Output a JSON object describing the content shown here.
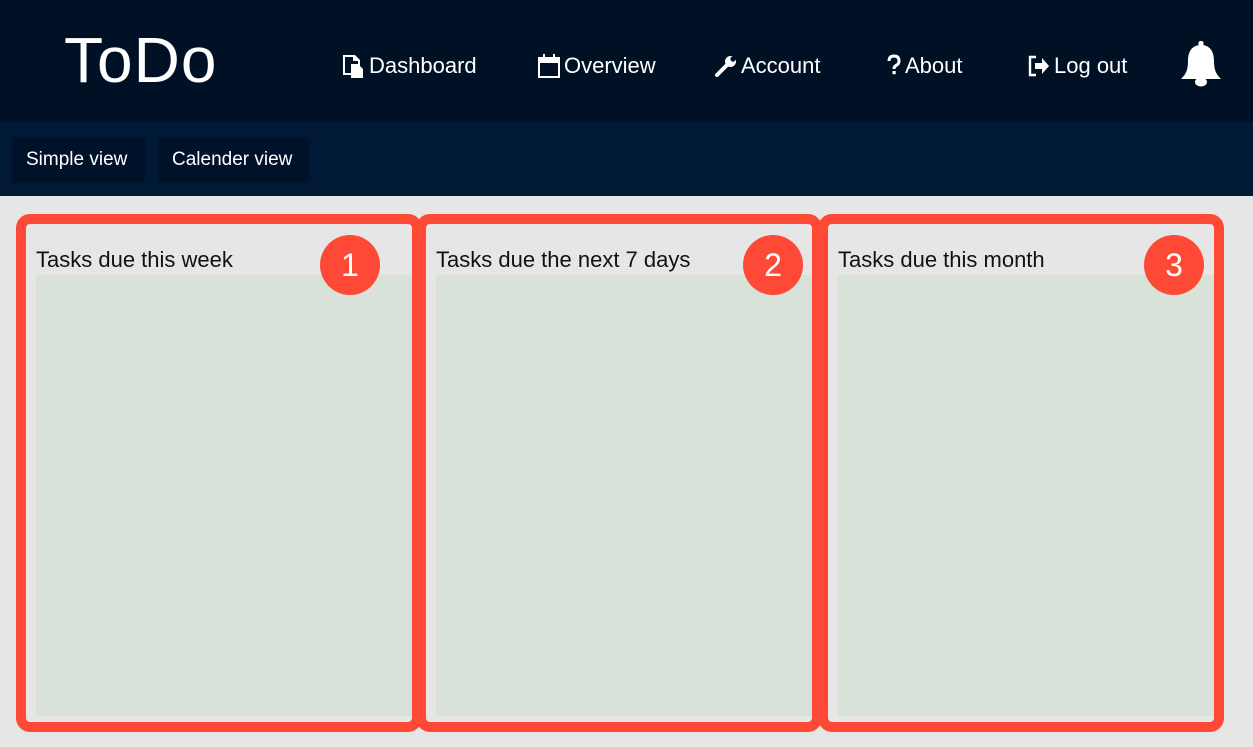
{
  "header": {
    "brand": "ToDo",
    "nav": [
      {
        "label": "Dashboard",
        "icon": "clipboard-icon"
      },
      {
        "label": "Overview",
        "icon": "calendar-icon"
      },
      {
        "label": "Account",
        "icon": "wrench-icon"
      },
      {
        "label": "About",
        "icon": "question-icon"
      },
      {
        "label": "Log out",
        "icon": "logout-icon"
      }
    ],
    "notification_icon": "bell-icon"
  },
  "toolbar": {
    "simple_view": "Simple view",
    "calendar_view": "Calender view"
  },
  "panels": [
    {
      "title": "Tasks due this week",
      "marker": "1"
    },
    {
      "title": "Tasks due the next 7 days",
      "marker": "2"
    },
    {
      "title": "Tasks due this month",
      "marker": "3"
    }
  ],
  "colors": {
    "header_bg": "#001025",
    "subbar_bg": "#001935",
    "page_bg": "#e6e6e6",
    "panel_area": "#d8e2d9",
    "highlight": "#ff4937"
  }
}
